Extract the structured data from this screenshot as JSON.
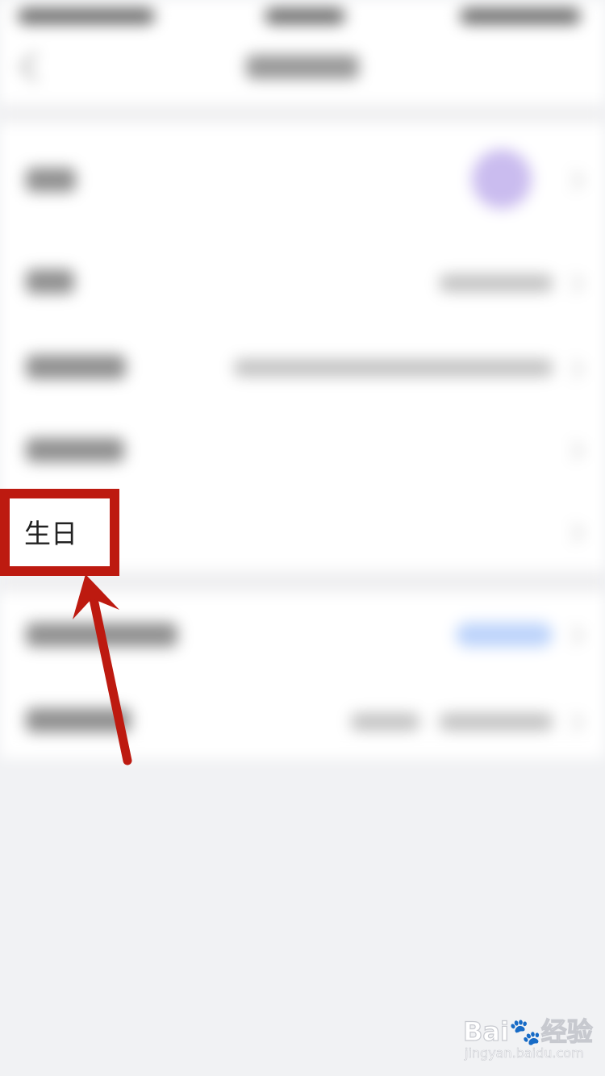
{
  "highlight": {
    "label": "生日"
  },
  "watermark": {
    "brand": "Bai🐾经验",
    "url": "jingyan.baidu.com"
  },
  "colors": {
    "annotation_red": "#bd1a10",
    "page_background": "#f1f2f4",
    "avatar_purple": "#b8a6ea",
    "button_blue": "#bcd3fb"
  },
  "icons": {
    "back": "chevron-left-icon",
    "row_arrow": "chevron-right-icon",
    "annotation_arrow": "arrow-up-icon"
  }
}
